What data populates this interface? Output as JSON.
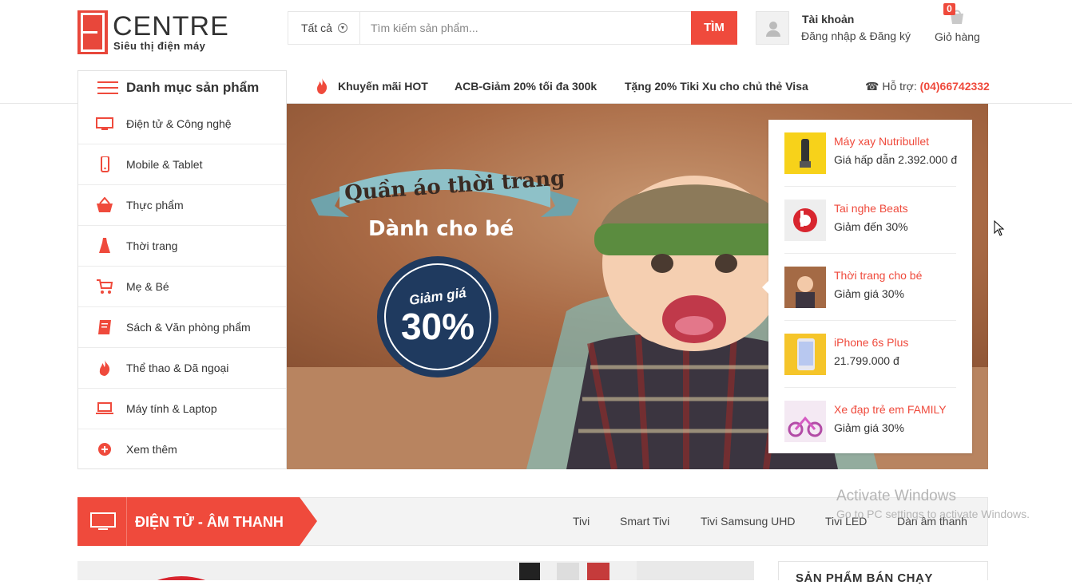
{
  "logo": {
    "word": "CENTRE",
    "tagline": "Siêu thị điện máy"
  },
  "search": {
    "category": "Tất cả",
    "placeholder": "Tìm kiếm sản phẩm...",
    "button": "TÌM"
  },
  "account": {
    "title": "Tài khoản",
    "links": "Đăng nhập & Đăng ký"
  },
  "cart": {
    "count": "0",
    "label": "Giỏ hàng"
  },
  "nav": {
    "categories_title": "Danh mục sản phẩm",
    "promos": [
      "Khuyến mãi HOT",
      "ACB-Giảm 20% tối đa 300k",
      "Tặng 20% Tiki Xu cho chủ thẻ Visa"
    ],
    "support_label": "Hỗ trợ:",
    "support_phone": "(04)66742332"
  },
  "sidebar": {
    "items": [
      {
        "label": "Điện tử & Công nghệ",
        "icon": "monitor-icon"
      },
      {
        "label": "Mobile & Tablet",
        "icon": "phone-icon"
      },
      {
        "label": "Thực phẩm",
        "icon": "basket-icon"
      },
      {
        "label": "Thời trang",
        "icon": "dress-icon"
      },
      {
        "label": "Mẹ & Bé",
        "icon": "stroller-icon"
      },
      {
        "label": "Sách & Văn phòng phẩm",
        "icon": "book-icon"
      },
      {
        "label": "Thể thao & Dã ngoại",
        "icon": "fire-icon"
      },
      {
        "label": "Máy tính & Laptop",
        "icon": "laptop-icon"
      },
      {
        "label": "Xem thêm",
        "icon": "plus-circle-icon"
      }
    ]
  },
  "banner": {
    "headline": "Quần áo thời trang",
    "subline": "Dành cho bé",
    "seal_label": "Giảm giá",
    "seal_value": "30%"
  },
  "hot_products": [
    {
      "name": "Máy xay Nutribullet",
      "price": "Giá hấp dẫn 2.392.000 đ"
    },
    {
      "name": "Tai nghe Beats",
      "price": "Giảm đến 30%"
    },
    {
      "name": "Thời trang cho bé",
      "price": "Giảm giá 30%"
    },
    {
      "name": "iPhone 6s Plus",
      "price": "21.799.000 đ"
    },
    {
      "name": "Xe đạp trẻ em FAMILY",
      "price": "Giảm giá 30%"
    }
  ],
  "section": {
    "title": "ĐIỆN TỬ - ÂM THANH",
    "tabs": [
      "Tivi",
      "Smart Tivi",
      "Tivi Samsung UHD",
      "Tivi LED",
      "Dàn âm thanh"
    ]
  },
  "best_sellers": {
    "title": "SẢN PHẨM BÁN CHẠY"
  },
  "os_watermark": {
    "line1": "Activate Windows",
    "line2": "Go to PC settings to activate Windows."
  },
  "colors": {
    "accent": "#ef4a3c",
    "text": "#333333",
    "border": "#e6e6e6"
  }
}
